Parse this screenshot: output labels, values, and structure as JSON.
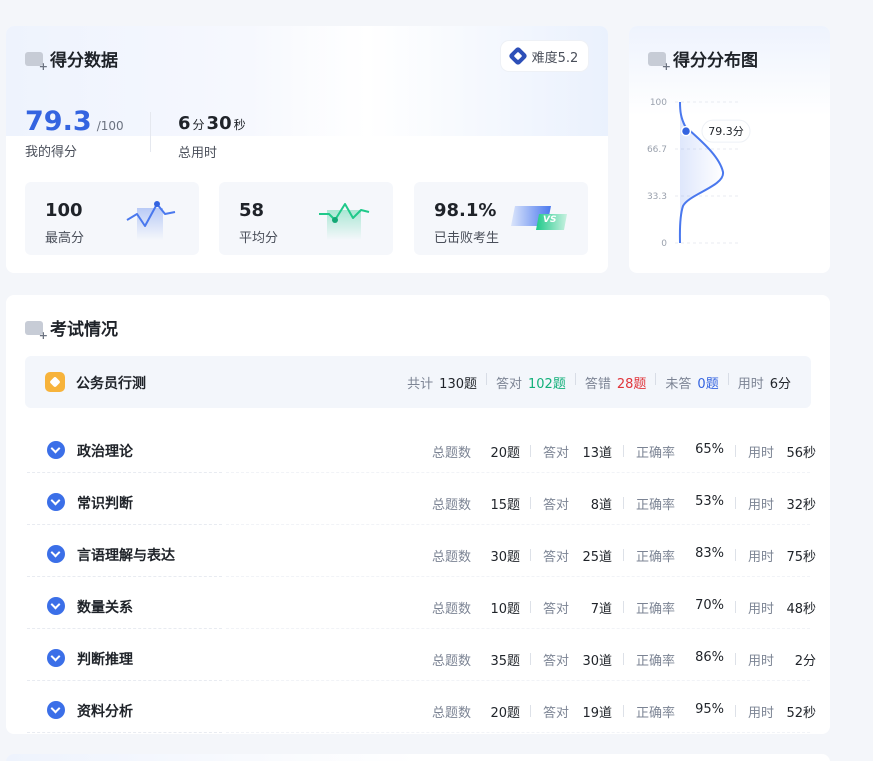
{
  "score_data": {
    "title": "得分数据",
    "difficulty": "难度5.2",
    "my_score": "79.3",
    "score_max": "/100",
    "my_score_label": "我的得分",
    "time_minutes": "6",
    "time_minutes_unit": "分",
    "time_seconds": "30",
    "time_seconds_unit": "秒",
    "time_label": "总用时",
    "stats": [
      {
        "value": "100",
        "label": "最高分",
        "icon": "line-peak-icon"
      },
      {
        "value": "58",
        "label": "平均分",
        "icon": "line-wave-icon"
      },
      {
        "value": "98.1%",
        "label": "已击败考生",
        "icon": "vs-icon",
        "icon_text": "VS"
      }
    ]
  },
  "distribution": {
    "title": "得分分布图",
    "y_ticks": [
      "100",
      "66.7",
      "33.3",
      "0"
    ],
    "marker_label": "79.3分",
    "marker_value": 79.3
  },
  "exam": {
    "title": "考试情况",
    "subject": {
      "name": "公务员行测",
      "total_label": "共计",
      "total": "130题",
      "correct_label": "答对",
      "correct": "102题",
      "wrong_label": "答错",
      "wrong": "28题",
      "unanswered_label": "未答",
      "unanswered": "0题",
      "time_label": "用时",
      "time": "6分"
    },
    "labels": {
      "total": "总题数",
      "correct": "答对",
      "accuracy": "正确率",
      "time": "用时"
    },
    "rows": [
      {
        "name": "政治理论",
        "total": "20题",
        "correct": "13道",
        "accuracy": "65%",
        "time": "56秒"
      },
      {
        "name": "常识判断",
        "total": "15题",
        "correct": "8道",
        "accuracy": "53%",
        "time": "32秒"
      },
      {
        "name": "言语理解与表达",
        "total": "30题",
        "correct": "25道",
        "accuracy": "83%",
        "time": "75秒"
      },
      {
        "name": "数量关系",
        "total": "10题",
        "correct": "7道",
        "accuracy": "70%",
        "time": "48秒"
      },
      {
        "name": "判断推理",
        "total": "35题",
        "correct": "30道",
        "accuracy": "86%",
        "time": "2分"
      },
      {
        "name": "资料分析",
        "total": "20题",
        "correct": "19道",
        "accuracy": "95%",
        "time": "52秒"
      }
    ]
  },
  "colors": {
    "accent": "#3464e0",
    "correct": "#13b07a",
    "wrong": "#e0353b",
    "unanswered": "#3464e0"
  }
}
